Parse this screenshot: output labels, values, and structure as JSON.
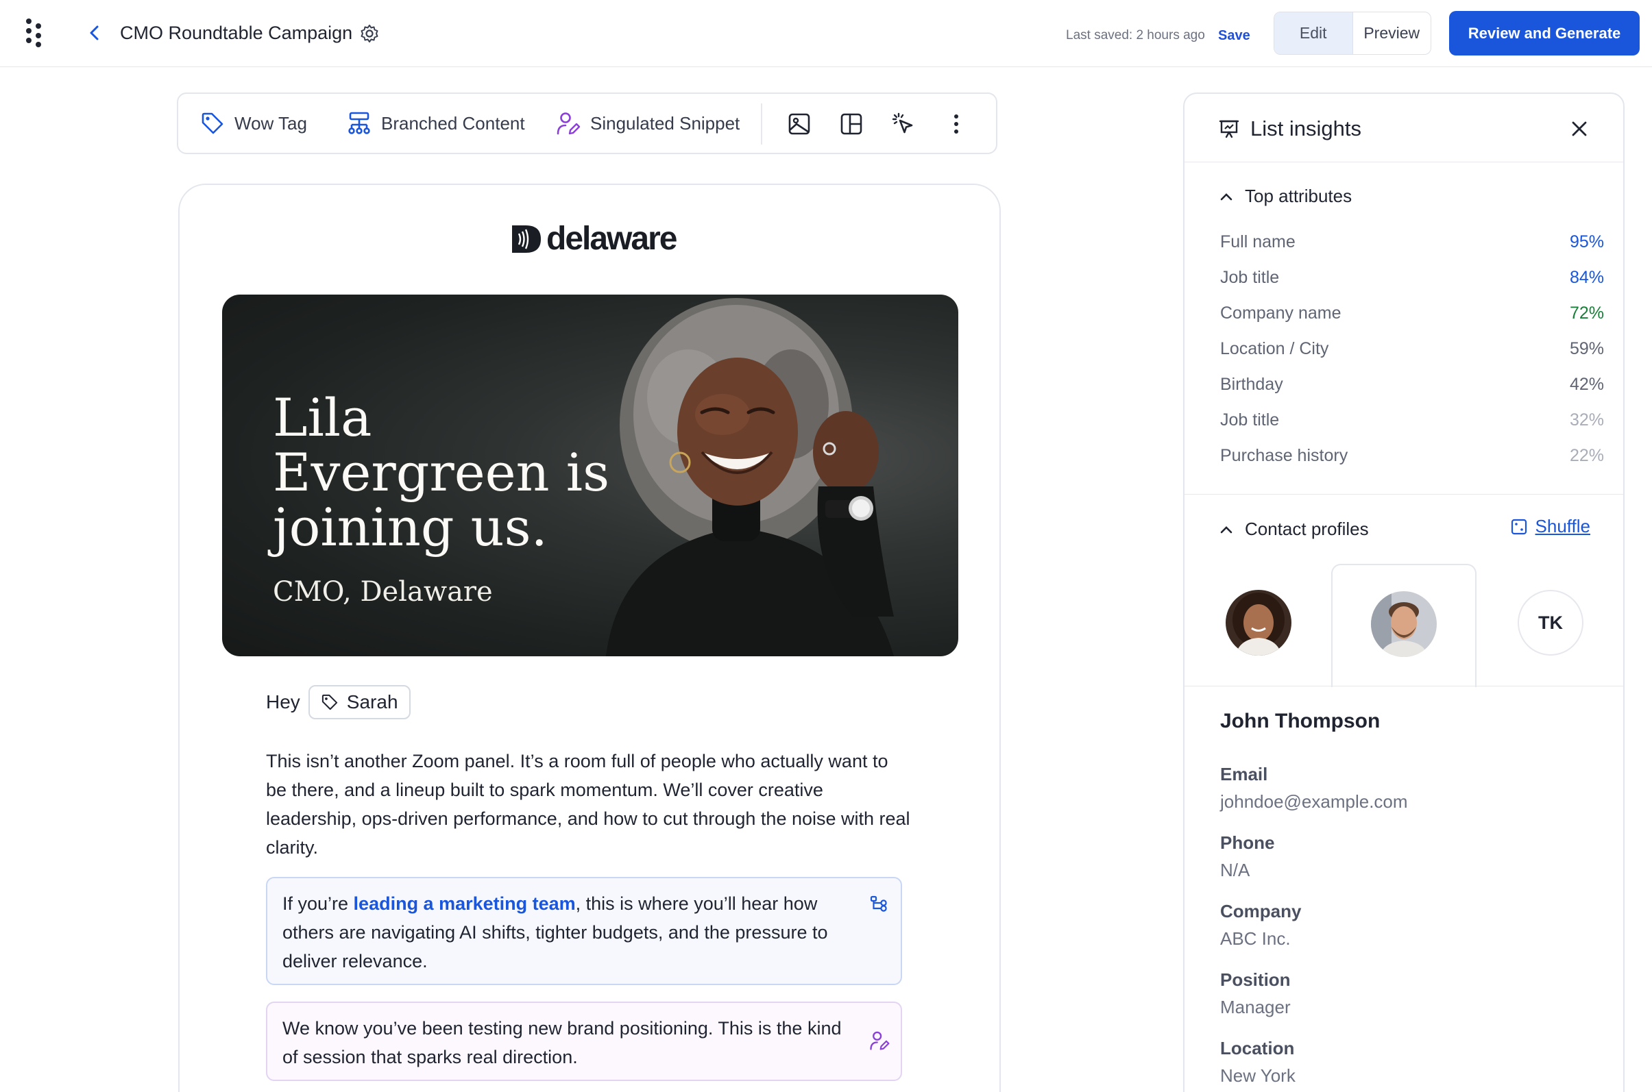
{
  "header": {
    "title": "CMO Roundtable Campaign",
    "last_saved": "Last saved: 2 hours ago",
    "save_label": "Save",
    "modes": [
      "Edit",
      "Preview"
    ],
    "active_mode": "Edit",
    "primary_action": "Review and Generate"
  },
  "toolbar": {
    "tools": [
      "Wow Tag",
      "Branched Content",
      "Singulated Snippet"
    ],
    "icon_tools": [
      "image-icon",
      "layout-icon",
      "cursor-click-icon",
      "more-vertical-icon"
    ]
  },
  "email": {
    "brand": "delaware",
    "hero": {
      "headline": "Lila Evergreen is joining us.",
      "subtitle": "CMO, Delaware"
    },
    "greeting": "Hey",
    "recipient_tag": "Sarah",
    "body": "This isn’t another Zoom panel. It’s a room full of people who actually want to be there, and a lineup built to spark momentum. We’ll cover creative leadership, ops-driven performance, and how to cut through the noise with real clarity.",
    "branched": {
      "prefix": "If you’re ",
      "highlight": "leading a marketing team",
      "suffix": ", this is where you’ll hear how others are navigating AI shifts, tighter budgets, and the pressure to deliver relevance."
    },
    "snippet": "We know you’ve been testing new brand positioning. This is the kind of session that sparks real direction."
  },
  "insights": {
    "title": "List insights",
    "top_attributes_label": "Top attributes",
    "attributes": [
      {
        "name": "Full name",
        "value": "95%",
        "color": "#1a56db"
      },
      {
        "name": "Job title",
        "value": "84%",
        "color": "#1a56db"
      },
      {
        "name": "Company name",
        "value": "72%",
        "color": "#188038"
      },
      {
        "name": "Location / City",
        "value": "59%",
        "color": "#5f6573"
      },
      {
        "name": "Birthday",
        "value": "42%",
        "color": "#5f6573"
      },
      {
        "name": "Job title",
        "value": "32%",
        "color": "#a8adb8"
      },
      {
        "name": "Purchase history",
        "value": "22%",
        "color": "#a8adb8"
      }
    ],
    "contact_profiles_label": "Contact profiles",
    "shuffle_label": "Shuffle",
    "profiles": [
      {
        "type": "photo",
        "icon": "avatar-woman"
      },
      {
        "type": "photo",
        "icon": "avatar-man",
        "active": true
      },
      {
        "type": "initials",
        "initials": "TK"
      }
    ],
    "contact": {
      "name": "John Thompson",
      "fields": [
        {
          "label": "Email",
          "value": "johndoe@example.com"
        },
        {
          "label": "Phone",
          "value": "N/A"
        },
        {
          "label": "Company",
          "value": "ABC Inc."
        },
        {
          "label": "Position",
          "value": "Manager"
        },
        {
          "label": "Location",
          "value": "New York"
        }
      ]
    }
  },
  "colors": {
    "accent": "#1a56db",
    "branched_border": "#c9d6f4",
    "snippet_border": "#e3d4f1",
    "snippet_icon": "#8b3fd9"
  }
}
